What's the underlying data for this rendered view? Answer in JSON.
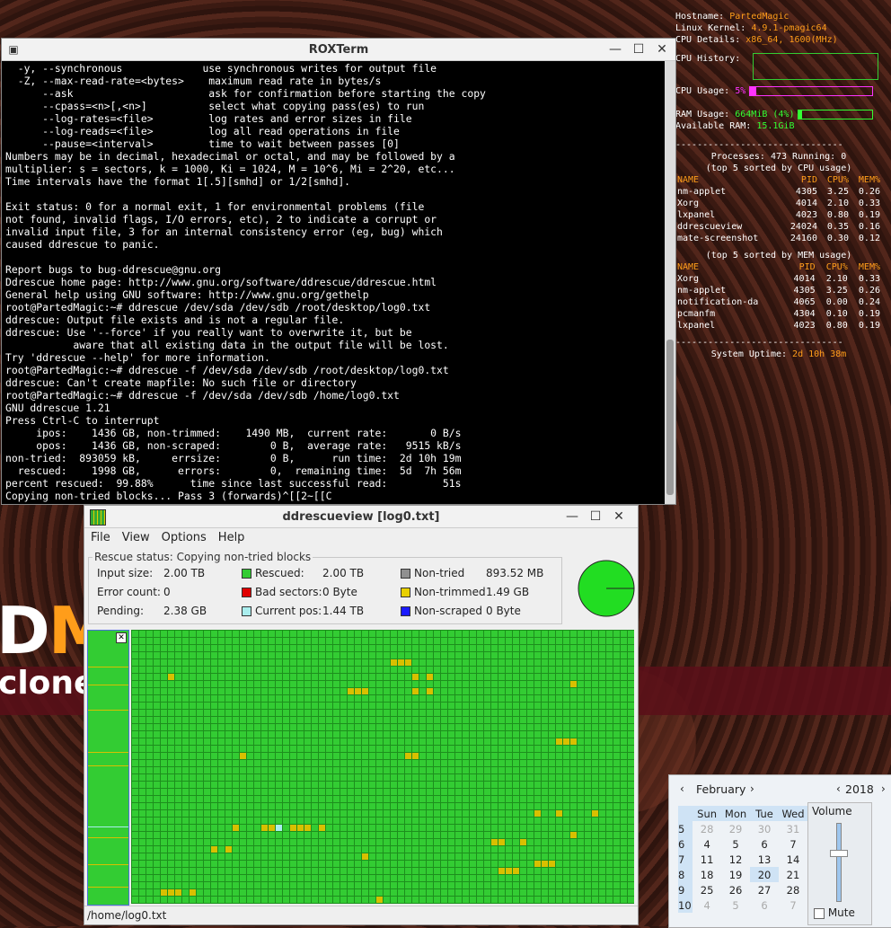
{
  "conky": {
    "hostname_label": "Hostname:",
    "hostname": "PartedMagic",
    "kernel_label": "Linux Kernel:",
    "kernel": "4.9.1-pmagic64",
    "cpu_details_label": "CPU Details:",
    "cpu_details": "x86_64, 1600(MHz)",
    "cpu_history_label": "CPU History:",
    "cpu_usage_label": "CPU Usage:",
    "cpu_usage": "5%",
    "cpu_usage_pct": 5,
    "ram_usage_label": "RAM Usage:",
    "ram_usage": "664MiB (4%)",
    "ram_usage_pct": 4,
    "avail_ram_label": "Available RAM:",
    "avail_ram": "15.1GiB",
    "divider": "-------------------------------",
    "procs_line": "Processes: 473  Running: 0",
    "cpu_sort_title": "(top 5 sorted by CPU usage)",
    "mem_sort_title": "(top 5 sorted by MEM usage)",
    "cols": [
      "NAME",
      "PID",
      "CPU%",
      "MEM%"
    ],
    "cpu_rows": [
      [
        "nm-applet",
        "4305",
        "3.25",
        "0.26"
      ],
      [
        "Xorg",
        "4014",
        "2.10",
        "0.33"
      ],
      [
        "lxpanel",
        "4023",
        "0.80",
        "0.19"
      ],
      [
        "ddrescueview",
        "24024",
        "0.35",
        "0.16"
      ],
      [
        "mate-screenshot",
        "24160",
        "0.30",
        "0.12"
      ]
    ],
    "mem_rows": [
      [
        "Xorg",
        "4014",
        "2.10",
        "0.33"
      ],
      [
        "nm-applet",
        "4305",
        "3.25",
        "0.26"
      ],
      [
        "notification-da",
        "4065",
        "0.00",
        "0.24"
      ],
      [
        "pcmanfm",
        "4304",
        "0.10",
        "0.19"
      ],
      [
        "lxpanel",
        "4023",
        "0.80",
        "0.19"
      ]
    ],
    "uptime_label": "System Uptime:",
    "uptime": "2d 10h 38m",
    "bar_magenta": "#ff00ff",
    "bar_green": "#33ff33"
  },
  "roxterm": {
    "title": "ROXTerm",
    "lines": [
      "  -y, --synchronous             use synchronous writes for output file",
      "  -Z, --max-read-rate=<bytes>    maximum read rate in bytes/s",
      "      --ask                      ask for confirmation before starting the copy",
      "      --cpass=<n>[,<n>]          select what copying pass(es) to run",
      "      --log-rates=<file>         log rates and error sizes in file",
      "      --log-reads=<file>         log all read operations in file",
      "      --pause=<interval>         time to wait between passes [0]",
      "Numbers may be in decimal, hexadecimal or octal, and may be followed by a",
      "multiplier: s = sectors, k = 1000, Ki = 1024, M = 10^6, Mi = 2^20, etc...",
      "Time intervals have the format 1[.5][smhd] or 1/2[smhd].",
      "",
      "Exit status: 0 for a normal exit, 1 for environmental problems (file",
      "not found, invalid flags, I/O errors, etc), 2 to indicate a corrupt or",
      "invalid input file, 3 for an internal consistency error (eg, bug) which",
      "caused ddrescue to panic.",
      "",
      "Report bugs to bug-ddrescue@gnu.org",
      "Ddrescue home page: http://www.gnu.org/software/ddrescue/ddrescue.html",
      "General help using GNU software: http://www.gnu.org/gethelp",
      "root@PartedMagic:~# ddrescue /dev/sda /dev/sdb /root/desktop/log0.txt",
      "ddrescue: Output file exists and is not a regular file.",
      "ddrescue: Use '--force' if you really want to overwrite it, but be",
      "           aware that all existing data in the output file will be lost.",
      "Try 'ddrescue --help' for more information.",
      "root@PartedMagic:~# ddrescue -f /dev/sda /dev/sdb /root/desktop/log0.txt",
      "ddrescue: Can't create mapfile: No such file or directory",
      "root@PartedMagic:~# ddrescue -f /dev/sda /dev/sdb /home/log0.txt",
      "GNU ddrescue 1.21",
      "Press Ctrl-C to interrupt",
      "     ipos:    1436 GB, non-trimmed:    1490 MB,  current rate:       0 B/s",
      "     opos:    1436 GB, non-scraped:        0 B,  average rate:   9515 kB/s",
      "non-tried:  893059 kB,     errsize:        0 B,      run time:  2d 10h 19m",
      "  rescued:    1998 GB,      errors:        0,  remaining time:  5d  7h 56m",
      "percent rescued:  99.88%      time since last successful read:         51s",
      "Copying non-tried blocks... Pass 3 (forwards)^[[2~[[C"
    ]
  },
  "ddv": {
    "title": "ddrescueview [log0.txt]",
    "menu": [
      "File",
      "View",
      "Options",
      "Help"
    ],
    "rescue_status_label": "Rescue status:",
    "rescue_status": "Copying non-tried blocks",
    "input_size_label": "Input size:",
    "input_size": "2.00 TB",
    "error_count_label": "Error count:",
    "error_count": "0",
    "pending_label": "Pending:",
    "pending": "2.38 GB",
    "rescued_label": "Rescued:",
    "rescued": "2.00 TB",
    "bad_sectors_label": "Bad sectors:",
    "bad_sectors": "0 Byte",
    "current_pos_label": "Current pos:",
    "current_pos": "1.44 TB",
    "nontried_label": "Non-tried",
    "nontried": "893.52 MB",
    "nontrimmed_label": "Non-trimmed",
    "nontrimmed": "1.49 GB",
    "nonscraped_label": "Non-scraped",
    "nonscraped": "0 Byte",
    "colors": {
      "rescued": "#33cc33",
      "bad": "#e00000",
      "current": "#aaeeee",
      "nontried": "#909090",
      "nontrimmed": "#e8d000",
      "nonscraped": "#1a1aff"
    },
    "status_path": "/home/log0.txt"
  },
  "logo": {
    "text1": "DM",
    "text2": "clone"
  },
  "calendar": {
    "month": "February",
    "year": "2018",
    "days_head": [
      "Sun",
      "Mon",
      "Tue",
      "Wed"
    ],
    "weeks": [
      {
        "wk": "5",
        "days": [
          "28",
          "29",
          "30",
          "31"
        ]
      },
      {
        "wk": "6",
        "days": [
          "4",
          "5",
          "6",
          "7"
        ]
      },
      {
        "wk": "7",
        "days": [
          "11",
          "12",
          "13",
          "14"
        ]
      },
      {
        "wk": "8",
        "days": [
          "18",
          "19",
          "20",
          "21"
        ]
      },
      {
        "wk": "9",
        "days": [
          "25",
          "26",
          "27",
          "28"
        ]
      },
      {
        "wk": "10",
        "days": [
          "4",
          "5",
          "6",
          "7"
        ]
      }
    ],
    "volume_label": "Volume",
    "mute_label": "Mute"
  }
}
